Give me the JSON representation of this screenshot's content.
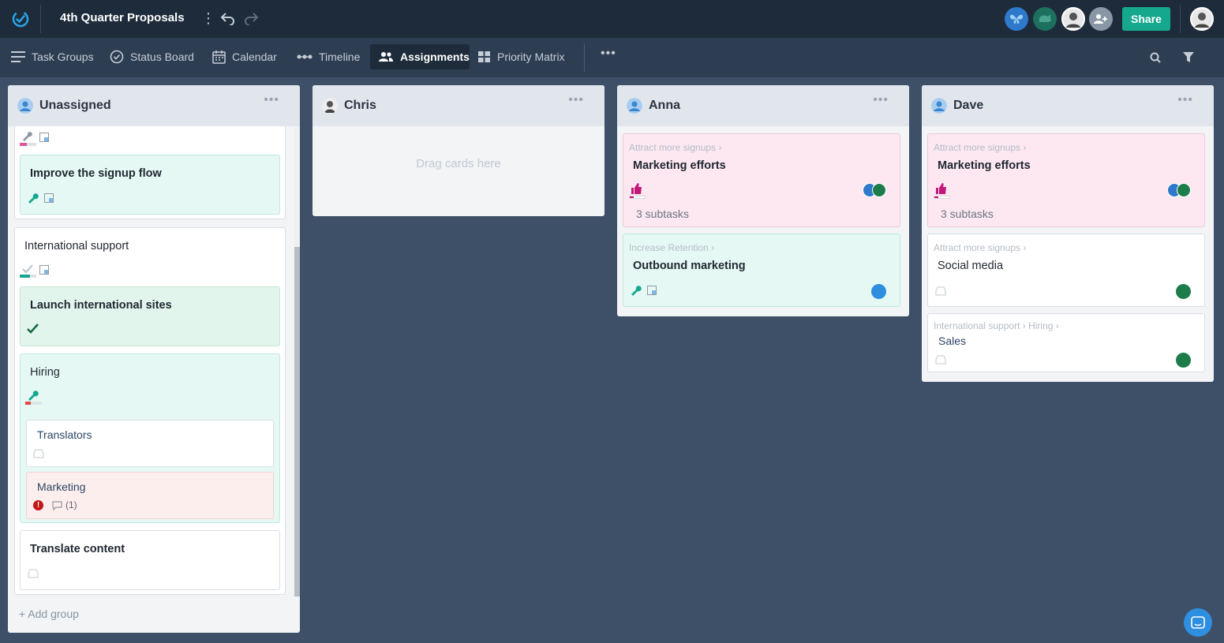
{
  "project": {
    "title": "4th Quarter Proposals"
  },
  "header": {
    "share_label": "Share"
  },
  "nav": {
    "tabs": [
      {
        "label": "Task Groups",
        "icon": "list-icon"
      },
      {
        "label": "Status Board",
        "icon": "check-circle-icon"
      },
      {
        "label": "Calendar",
        "icon": "calendar-icon"
      },
      {
        "label": "Timeline",
        "icon": "timeline-icon"
      },
      {
        "label": "Assignments",
        "icon": "people-icon",
        "active": true
      },
      {
        "label": "Priority Matrix",
        "icon": "grid-icon"
      }
    ]
  },
  "columns": {
    "unassigned": {
      "name": "Unassigned",
      "cards": {
        "improve": {
          "title": "Improve the signup flow"
        },
        "intl_group": {
          "title": "International support"
        },
        "launch": {
          "title": "Launch international sites"
        },
        "hiring": {
          "title": "Hiring",
          "subtasks": [
            {
              "title": "Translators"
            },
            {
              "title": "Marketing",
              "comments": "(1)"
            }
          ]
        },
        "translate": {
          "title": "Translate content"
        }
      },
      "add_group": "+ Add group"
    },
    "chris": {
      "name": "Chris",
      "empty_hint": "Drag cards here"
    },
    "anna": {
      "name": "Anna",
      "cards": [
        {
          "crumb": "Attract more signups",
          "title": "Marketing efforts",
          "subtasks": "3 subtasks"
        },
        {
          "crumb": "Increase Retention",
          "title": "Outbound marketing"
        }
      ]
    },
    "dave": {
      "name": "Dave",
      "cards": [
        {
          "crumb": "Attract more signups",
          "title": "Marketing efforts",
          "subtasks": "3 subtasks"
        },
        {
          "crumb": "Attract more signups",
          "title": "Social media"
        },
        {
          "crumb_1": "International support",
          "crumb_2": "Hiring",
          "title": "Sales"
        }
      ]
    }
  },
  "colors": {
    "topbar": "#1d2b3a",
    "navbar": "#2e3e52",
    "board": "#3d5068",
    "accent": "#16a88f",
    "pink_card": "#fde8f2",
    "mint_card": "#e6f8f4"
  }
}
